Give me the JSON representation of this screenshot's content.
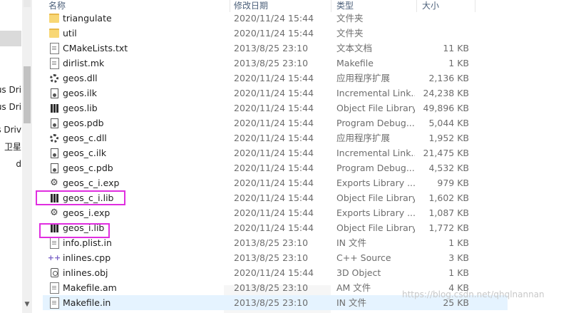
{
  "nav": {
    "items": [
      "us Dri",
      "us Dri",
      "s Driv",
      "卫星",
      "d"
    ]
  },
  "columns": {
    "name": "名称",
    "date": "修改日期",
    "type": "类型",
    "size": "大小"
  },
  "files": [
    {
      "name": "triangulate",
      "date": "2020/11/24 15:44",
      "type": "文件夹",
      "size": "",
      "icon": "folder-icon"
    },
    {
      "name": "util",
      "date": "2020/11/24 15:44",
      "type": "文件夹",
      "size": "",
      "icon": "folder-icon"
    },
    {
      "name": "CMakeLists.txt",
      "date": "2013/8/25 23:10",
      "type": "文本文档",
      "size": "11 KB",
      "icon": "text-file-icon"
    },
    {
      "name": "dirlist.mk",
      "date": "2013/8/25 23:10",
      "type": "Makefile",
      "size": "1 KB",
      "icon": "file-icon"
    },
    {
      "name": "geos.dll",
      "date": "2020/11/24 15:44",
      "type": "应用程序扩展",
      "size": "2,136 KB",
      "icon": "dll-gear-icon"
    },
    {
      "name": "geos.ilk",
      "date": "2020/11/24 15:44",
      "type": "Incremental Link...",
      "size": "24,238 KB",
      "icon": "ilk-file-icon"
    },
    {
      "name": "geos.lib",
      "date": "2020/11/24 15:44",
      "type": "Object File Library",
      "size": "49,896 KB",
      "icon": "library-icon"
    },
    {
      "name": "geos.pdb",
      "date": "2020/11/24 15:44",
      "type": "Program Debug...",
      "size": "5,044 KB",
      "icon": "pdb-file-icon"
    },
    {
      "name": "geos_c.dll",
      "date": "2020/11/24 15:44",
      "type": "应用程序扩展",
      "size": "1,952 KB",
      "icon": "dll-gear-icon"
    },
    {
      "name": "geos_c.ilk",
      "date": "2020/11/24 15:44",
      "type": "Incremental Link...",
      "size": "21,475 KB",
      "icon": "ilk-file-icon"
    },
    {
      "name": "geos_c.pdb",
      "date": "2020/11/24 15:44",
      "type": "Program Debug...",
      "size": "4,532 KB",
      "icon": "pdb-file-icon"
    },
    {
      "name": "geos_c_i.exp",
      "date": "2020/11/24 15:44",
      "type": "Exports Library ...",
      "size": "979 KB",
      "icon": "exp-file-icon"
    },
    {
      "name": "geos_c_i.lib",
      "date": "2020/11/24 15:44",
      "type": "Object File Library",
      "size": "1,602 KB",
      "icon": "library-icon"
    },
    {
      "name": "geos_i.exp",
      "date": "2020/11/24 15:44",
      "type": "Exports Library ...",
      "size": "1,087 KB",
      "icon": "exp-file-icon"
    },
    {
      "name": "geos_i.lib",
      "date": "2020/11/24 15:44",
      "type": "Object File Library",
      "size": "1,772 KB",
      "icon": "library-icon"
    },
    {
      "name": "info.plist.in",
      "date": "2013/8/25 23:10",
      "type": "IN 文件",
      "size": "1 KB",
      "icon": "file-icon"
    },
    {
      "name": "inlines.cpp",
      "date": "2013/8/25 23:10",
      "type": "C++ Source",
      "size": "3 KB",
      "icon": "cpp-file-icon"
    },
    {
      "name": "inlines.obj",
      "date": "2020/11/24 15:44",
      "type": "3D Object",
      "size": "1 KB",
      "icon": "obj-file-icon"
    },
    {
      "name": "Makefile.am",
      "date": "2013/8/25 23:10",
      "type": "AM 文件",
      "size": "4 KB",
      "icon": "file-icon"
    },
    {
      "name": "Makefile.in",
      "date": "2013/8/25 23:10",
      "type": "IN 文件",
      "size": "25 KB",
      "icon": "file-icon"
    }
  ],
  "watermark": "https://blog.csdn.net/qhqlnannan"
}
